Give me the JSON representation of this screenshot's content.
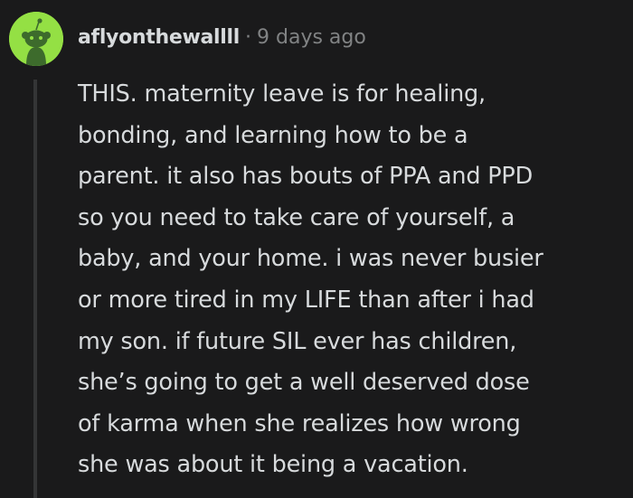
{
  "comment": {
    "username": "aflyonthewallll",
    "separator": "·",
    "timestamp": "9 days ago",
    "avatar_icon": "snoo-avatar-icon",
    "avatar_color": "#94e044",
    "body_lines": [
      "THIS. maternity leave is for healing,",
      "bonding, and learning how to be a",
      "parent. it also has bouts of PPA and PPD",
      "so you need to take care of yourself, a",
      "baby, and your home. i was never busier",
      "or more tired in my LIFE than after i had",
      "my son. if future SIL ever has children,",
      "she’s going to get a well deserved dose",
      "of karma when she realizes how wrong",
      "she was about it being a vacation."
    ]
  },
  "colors": {
    "background": "#1a1a1b",
    "text": "#d7dadc",
    "meta": "#818384",
    "thread_line": "#343536"
  }
}
